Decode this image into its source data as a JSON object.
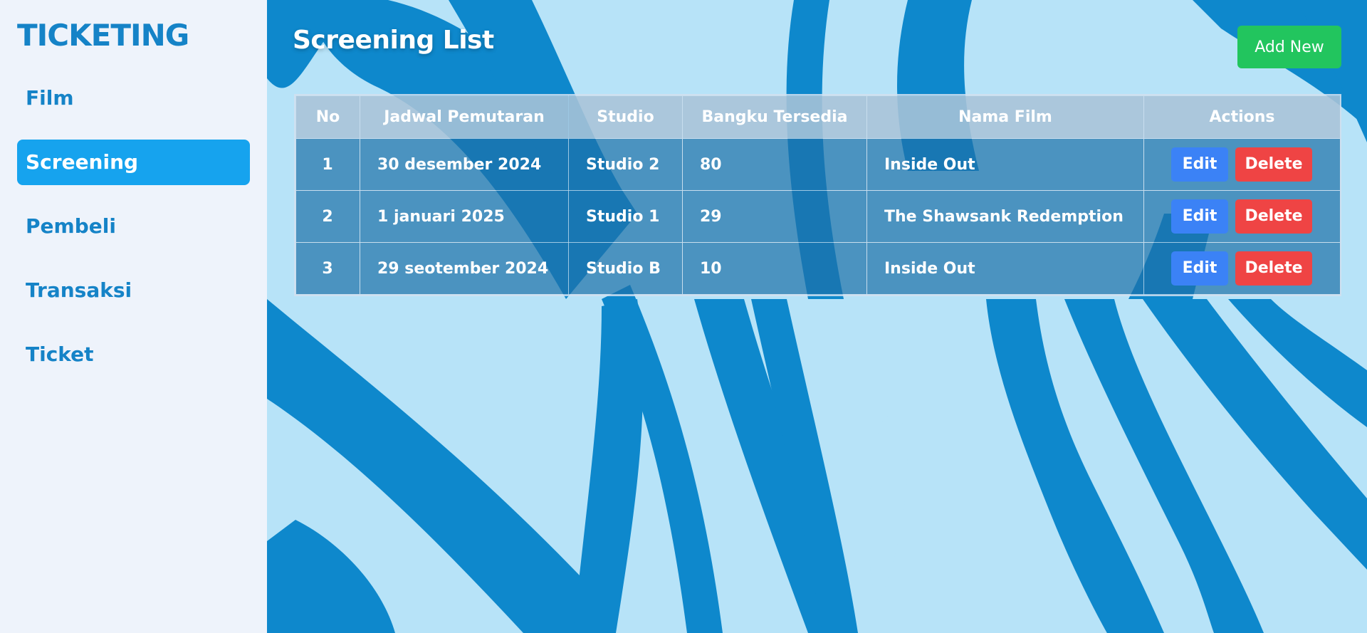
{
  "sidebar": {
    "brand": "TICKETING",
    "items": [
      {
        "label": "Film",
        "active": false
      },
      {
        "label": "Screening",
        "active": true
      },
      {
        "label": "Pembeli",
        "active": false
      },
      {
        "label": "Transaksi",
        "active": false
      },
      {
        "label": "Ticket",
        "active": false
      }
    ]
  },
  "main": {
    "title": "Screening List",
    "add_button_label": "Add New",
    "table": {
      "columns": [
        "No",
        "Jadwal Pemutaran",
        "Studio",
        "Bangku Tersedia",
        "Nama Film",
        "Actions"
      ],
      "rows": [
        {
          "no": "1",
          "jadwal": "30 desember 2024",
          "studio": "Studio 2",
          "bangku": "80",
          "film": "Inside Out",
          "edit": "Edit",
          "delete": "Delete"
        },
        {
          "no": "2",
          "jadwal": "1 januari 2025",
          "studio": "Studio 1",
          "bangku": "29",
          "film": "The Shawsank Redemption",
          "edit": "Edit",
          "delete": "Delete"
        },
        {
          "no": "3",
          "jadwal": "29 seotember 2024",
          "studio": "Studio B",
          "bangku": "10",
          "film": "Inside Out",
          "edit": "Edit",
          "delete": "Delete"
        }
      ]
    }
  },
  "colors": {
    "brand": "#1583c7",
    "sidebar_bg": "#eef3fb",
    "active_item": "#16a3ee",
    "background_light": "#b7e3f8",
    "background_dark": "#0e88cc",
    "add_button": "#22c55e",
    "edit_button": "#3b82f6",
    "delete_button": "#ef4444"
  }
}
